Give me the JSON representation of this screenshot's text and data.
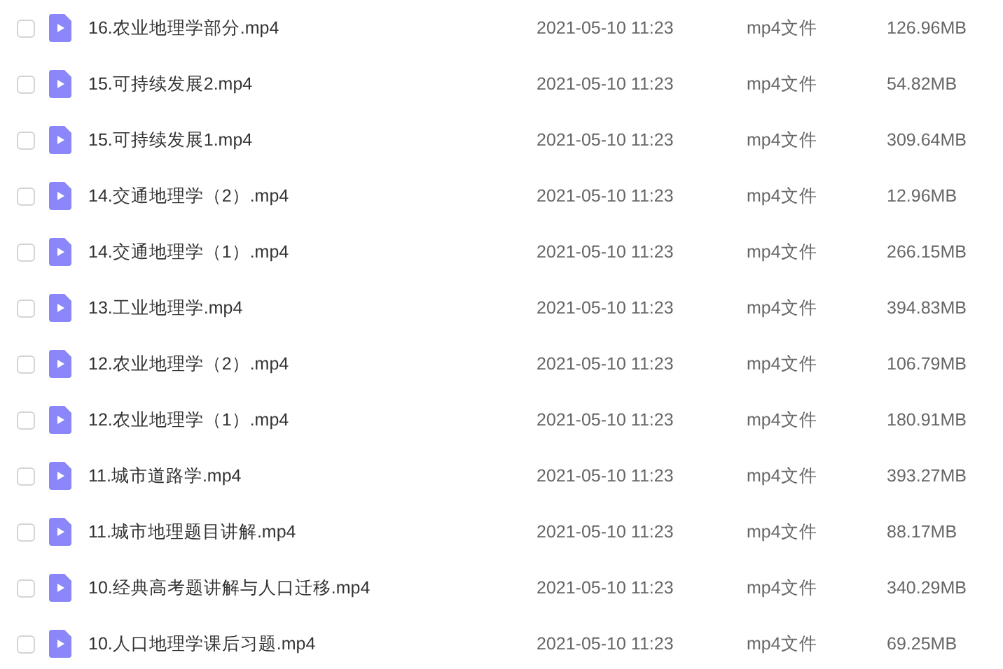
{
  "files": [
    {
      "name": "16.农业地理学部分.mp4",
      "date": "2021-05-10 11:23",
      "type": "mp4文件",
      "size": "126.96MB",
      "checked": false
    },
    {
      "name": "15.可持续发展2.mp4",
      "date": "2021-05-10 11:23",
      "type": "mp4文件",
      "size": "54.82MB",
      "checked": false
    },
    {
      "name": "15.可持续发展1.mp4",
      "date": "2021-05-10 11:23",
      "type": "mp4文件",
      "size": "309.64MB",
      "checked": false
    },
    {
      "name": "14.交通地理学（2）.mp4",
      "date": "2021-05-10 11:23",
      "type": "mp4文件",
      "size": "12.96MB",
      "checked": false
    },
    {
      "name": "14.交通地理学（1）.mp4",
      "date": "2021-05-10 11:23",
      "type": "mp4文件",
      "size": "266.15MB",
      "checked": false
    },
    {
      "name": "13.工业地理学.mp4",
      "date": "2021-05-10 11:23",
      "type": "mp4文件",
      "size": "394.83MB",
      "checked": false
    },
    {
      "name": "12.农业地理学（2）.mp4",
      "date": "2021-05-10 11:23",
      "type": "mp4文件",
      "size": "106.79MB",
      "checked": false
    },
    {
      "name": "12.农业地理学（1）.mp4",
      "date": "2021-05-10 11:23",
      "type": "mp4文件",
      "size": "180.91MB",
      "checked": false
    },
    {
      "name": "11.城市道路学.mp4",
      "date": "2021-05-10 11:23",
      "type": "mp4文件",
      "size": "393.27MB",
      "checked": false
    },
    {
      "name": "11.城市地理题目讲解.mp4",
      "date": "2021-05-10 11:23",
      "type": "mp4文件",
      "size": "88.17MB",
      "checked": false
    },
    {
      "name": "10.经典高考题讲解与人口迁移.mp4",
      "date": "2021-05-10 11:23",
      "type": "mp4文件",
      "size": "340.29MB",
      "checked": false
    },
    {
      "name": "10.人口地理学课后习题.mp4",
      "date": "2021-05-10 11:23",
      "type": "mp4文件",
      "size": "69.25MB",
      "checked": false
    }
  ]
}
